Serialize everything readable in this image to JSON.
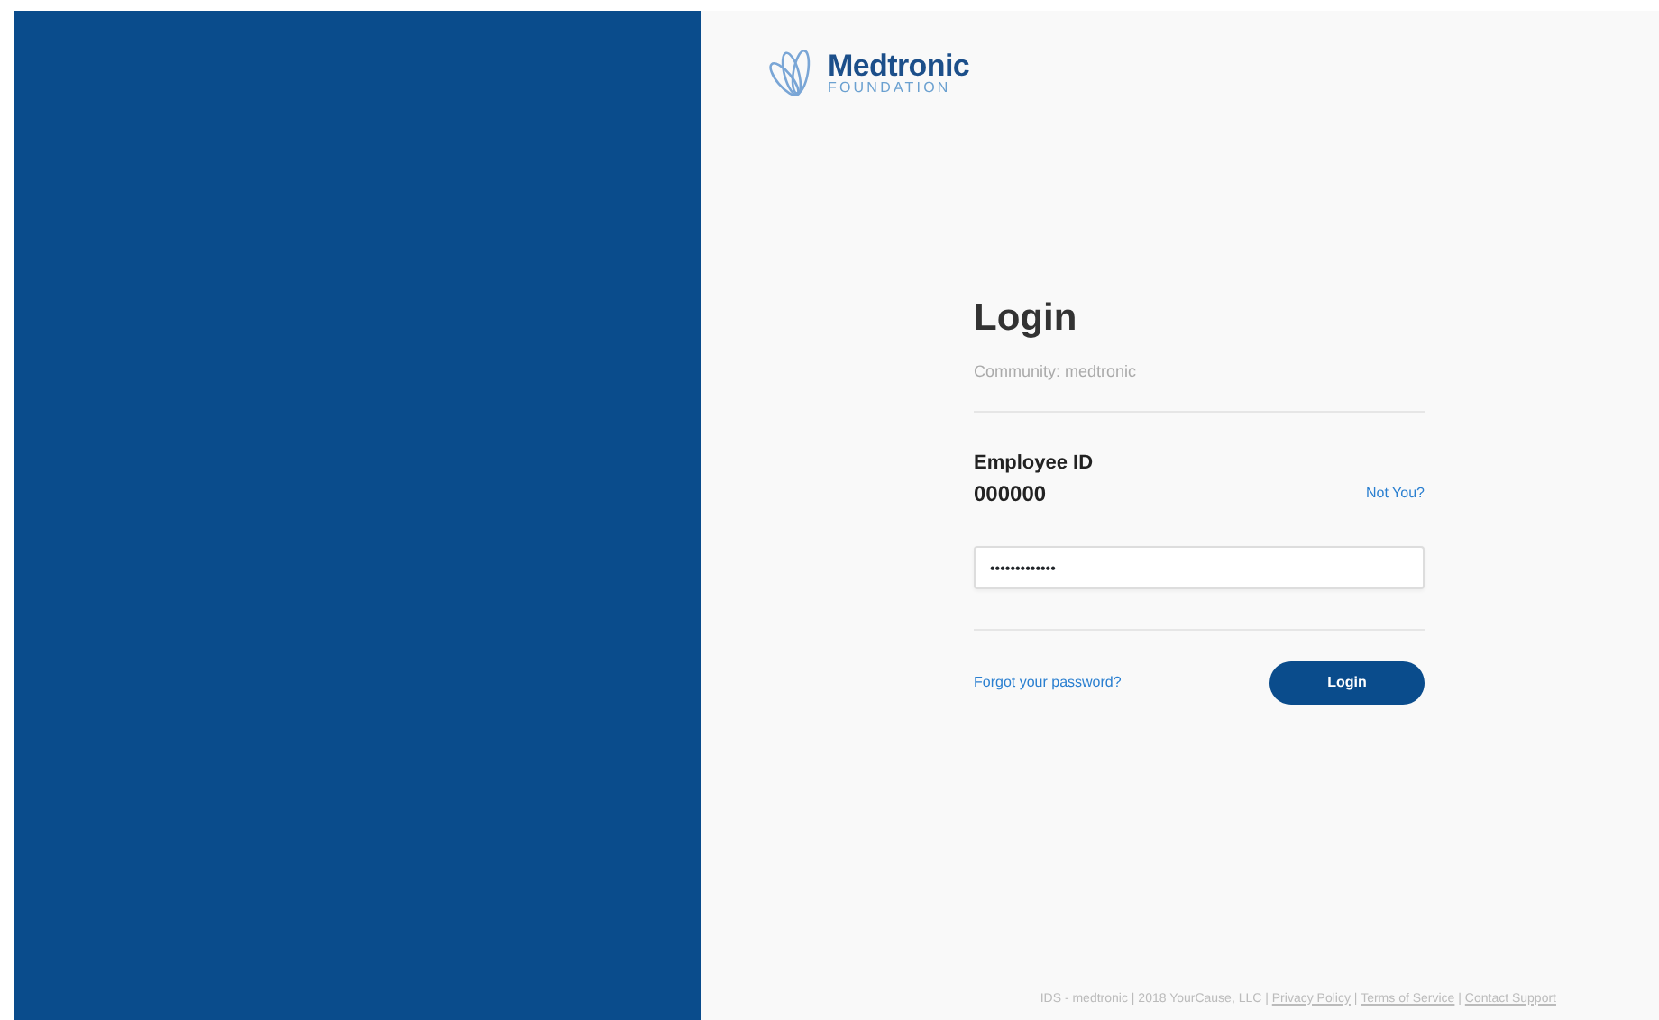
{
  "logo": {
    "name": "Medtronic",
    "subtitle": "FOUNDATION"
  },
  "login": {
    "title": "Login",
    "community": "Community: medtronic",
    "id_label": "Employee ID",
    "id_value": "000000",
    "not_you": "Not You?",
    "password": {
      "value": "•••••••••••••"
    },
    "forgot": "Forgot your password?",
    "button": "Login"
  },
  "footer_separator": "|",
  "footer": [
    {
      "text": "IDS - medtronic",
      "kind": "text"
    },
    {
      "text": "2018 YourCause, LLC",
      "kind": "text"
    },
    {
      "text": "Privacy Policy",
      "kind": "link"
    },
    {
      "text": "Terms of Service",
      "kind": "link"
    },
    {
      "text": "Contact Support",
      "kind": "link"
    }
  ]
}
